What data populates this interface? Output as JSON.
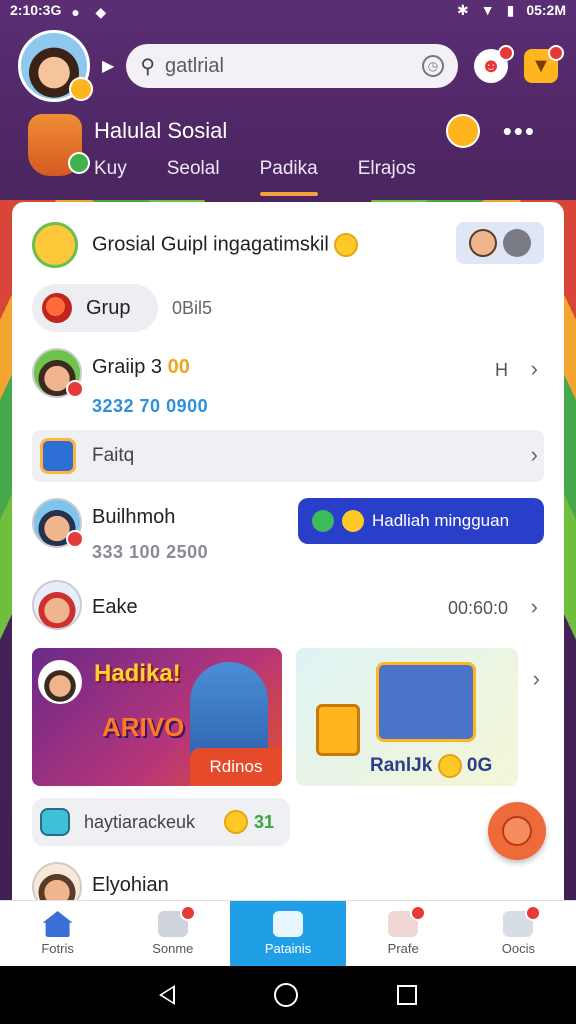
{
  "status": {
    "time_left": "2:10:3G",
    "time_right": "05:2M"
  },
  "search": {
    "placeholder": "gatlrial"
  },
  "social": {
    "title": "Halulal Sosial",
    "tabs": [
      "Kuy",
      "Seolal",
      "Padika",
      "Elrajos"
    ],
    "active_tab": 2
  },
  "groups": {
    "title": "Grosial Guipl ingagatimskil",
    "grup_label": "Grup",
    "grup_meta": "0Bil5"
  },
  "list": [
    {
      "name": "Graiip 3",
      "coins": "00",
      "number": "3232 70 0900",
      "meta": "H"
    },
    {
      "name": "Faitq"
    },
    {
      "name": "Builhmoh",
      "number": "333 100 2500",
      "button": "Hadliah mingguan"
    },
    {
      "name": "Eake",
      "meta": "00:60:0"
    },
    {
      "name": "Elyohian"
    }
  ],
  "promos": {
    "left_title": "Hadika!",
    "left_sub": "ARIVO",
    "left_button": "Rdinos",
    "right_label": "RanlJk",
    "right_value": "0G"
  },
  "hay": {
    "label": "haytiarackeuk",
    "value": "31"
  },
  "nav": {
    "items": [
      "Fotris",
      "Sonme",
      "Patainis",
      "Prafe",
      "Oocis"
    ],
    "active": 2
  },
  "colors": {
    "accent": "#1fa0e6",
    "header_bg": "#4b2560",
    "reward_button": "#2a3fc9"
  }
}
